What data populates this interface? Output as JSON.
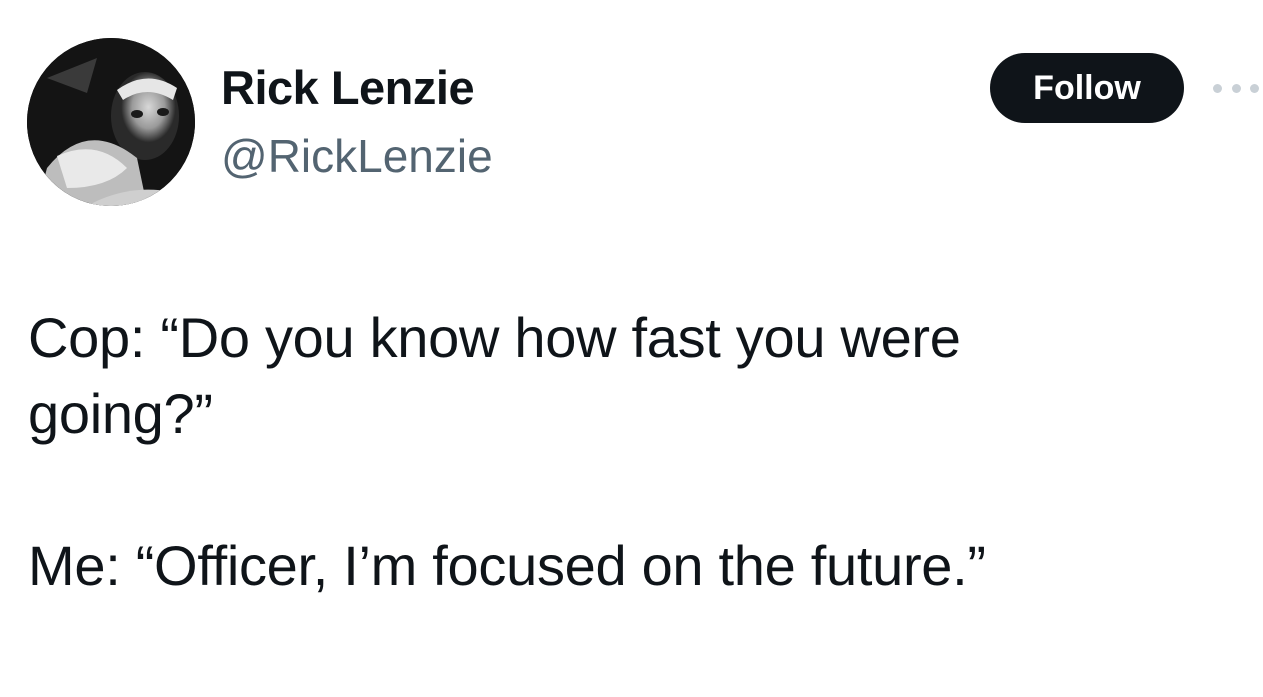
{
  "author": {
    "display_name": "Rick Lenzie",
    "handle": "@RickLenzie",
    "avatar_icon": "profile-photo-bw"
  },
  "actions": {
    "follow_label": "Follow",
    "more_icon": "ellipsis-icon"
  },
  "tweet": {
    "lines": [
      "Cop: “Do you know how fast you were",
      "going?”",
      "Me: “Officer, I’m focused on the future.”"
    ]
  },
  "colors": {
    "text": "#0f1419",
    "secondary_text": "#536471",
    "follow_bg": "#0f1419",
    "follow_text": "#ffffff",
    "more_dots": "#c9d0d6"
  }
}
